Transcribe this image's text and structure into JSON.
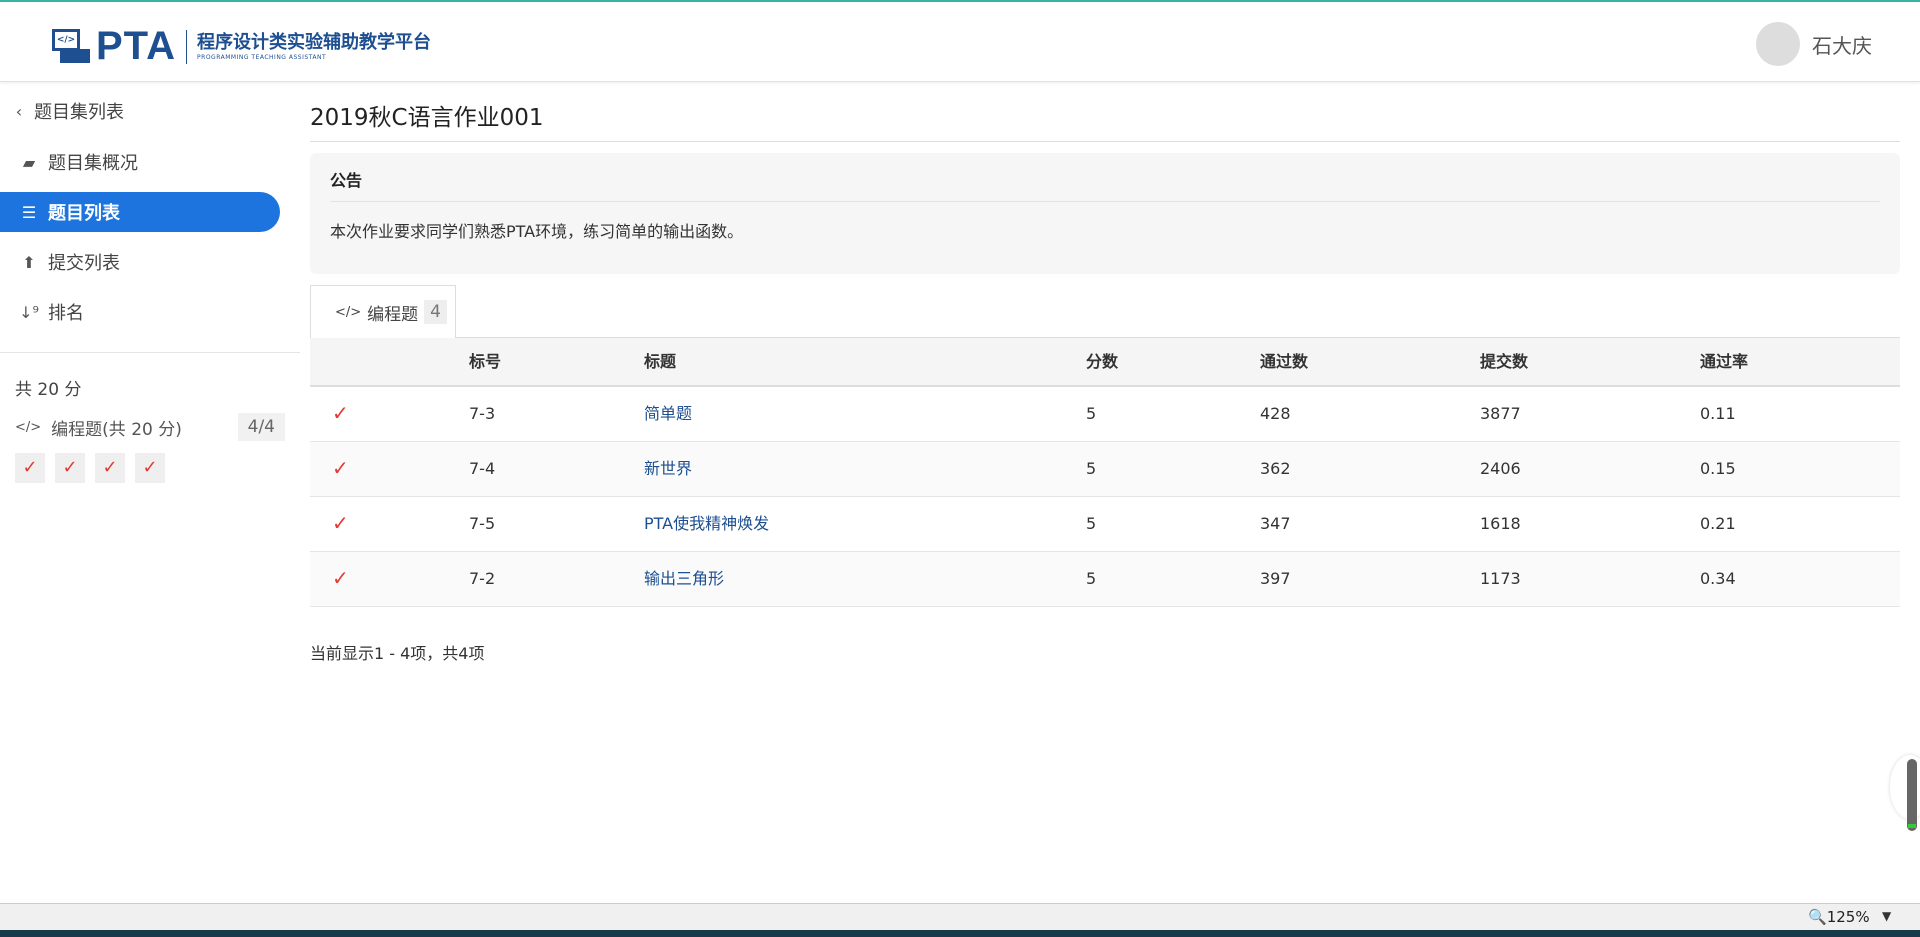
{
  "header": {
    "logo_text": "PTA",
    "logo_cn": "程序设计类实验辅助教学平台",
    "logo_en": "PROGRAMMING TEACHING ASSISTANT",
    "user_name": "石大庆"
  },
  "sidebar": {
    "back": "题目集列表",
    "items": [
      {
        "label": "题目集概况",
        "icon": "book-icon"
      },
      {
        "label": "题目列表",
        "icon": "list-icon",
        "active": true
      },
      {
        "label": "提交列表",
        "icon": "upload-icon"
      },
      {
        "label": "排名",
        "icon": "sort-icon"
      }
    ],
    "total": "共 20 分",
    "category": {
      "label": "编程题(共 20 分)",
      "count": "4/4"
    },
    "checks": [
      "✓",
      "✓",
      "✓",
      "✓"
    ]
  },
  "main": {
    "title": "2019秋C语言作业001",
    "notice": {
      "heading": "公告",
      "text": "本次作业要求同学们熟悉PTA环境，练习简单的输出函数。"
    },
    "tab": {
      "label": "编程题",
      "count": "4"
    },
    "columns": [
      "",
      "标号",
      "标题",
      "分数",
      "通过数",
      "提交数",
      "通过率"
    ],
    "rows": [
      {
        "status": "✓",
        "id": "7-3",
        "title": "简单题",
        "score": "5",
        "passed": "428",
        "submitted": "3877",
        "rate": "0.11"
      },
      {
        "status": "✓",
        "id": "7-4",
        "title": "新世界",
        "score": "5",
        "passed": "362",
        "submitted": "2406",
        "rate": "0.15"
      },
      {
        "status": "✓",
        "id": "7-5",
        "title": "PTA使我精神焕发",
        "score": "5",
        "passed": "347",
        "submitted": "1618",
        "rate": "0.21"
      },
      {
        "status": "✓",
        "id": "7-2",
        "title": "输出三角形",
        "score": "5",
        "passed": "397",
        "submitted": "1173",
        "rate": "0.34"
      }
    ],
    "footer": "当前显示1 - 4项，共4项"
  },
  "statusbar": {
    "zoom": "125%"
  }
}
